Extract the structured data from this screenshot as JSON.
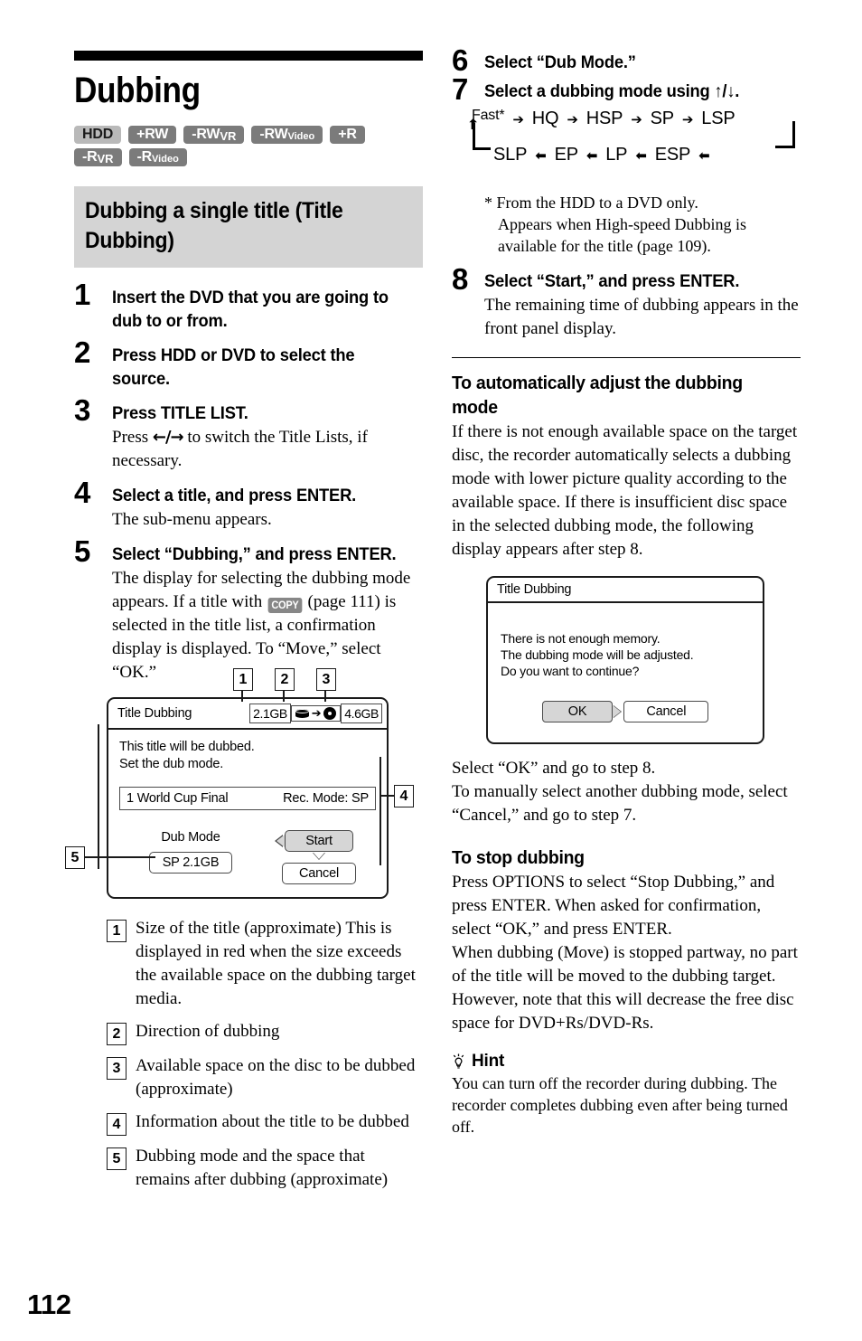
{
  "page": {
    "number": "112"
  },
  "left": {
    "chapter_title": "Dubbing",
    "media_badges": [
      {
        "name": "HDD",
        "main": "HDD",
        "sub": "",
        "style": "light"
      },
      {
        "name": "+RW",
        "main": "+RW",
        "sub": "",
        "style": "dark"
      },
      {
        "name": "-RWVR",
        "main": "-RW",
        "sub": "VR",
        "style": "dark"
      },
      {
        "name": "-RWVideo",
        "main": "-RW",
        "sub": "Video",
        "style": "dark"
      },
      {
        "name": "+R",
        "main": "+R",
        "sub": "",
        "style": "dark"
      },
      {
        "name": "-RVR",
        "main": "-R",
        "sub": "VR",
        "style": "dark"
      },
      {
        "name": "-RVideo",
        "main": "-R",
        "sub": "Video",
        "style": "dark"
      }
    ],
    "section_heading": "Dubbing a single title (Title Dubbing)",
    "steps": [
      {
        "num": "1",
        "title": "Insert the DVD that you are going to dub to or from.",
        "body": ""
      },
      {
        "num": "2",
        "title": "Press HDD or DVD to select the source.",
        "body": ""
      },
      {
        "num": "3",
        "title": "Press TITLE LIST.",
        "body_pre": "Press ",
        "body_arrows": "←/→",
        "body_post": " to switch the Title Lists, if necessary."
      },
      {
        "num": "4",
        "title": "Select a title, and press ENTER.",
        "body": "The sub-menu appears."
      },
      {
        "num": "5",
        "title": "Select “Dubbing,” and press ENTER.",
        "body_line1": "The display for selecting the dubbing mode appears.",
        "body_line2_pre": "If a title with ",
        "copy_badge": "COPY",
        "body_line2_post": " (page 111) is selected in the title list, a confirmation display is displayed.",
        "body_line3": "To “Move,” select “OK.”"
      }
    ],
    "dialog": {
      "title": "Title Dubbing",
      "size_source": "2.1GB",
      "direction_arrow": "➔",
      "size_target": "4.6GB",
      "message_line1": "This title will be dubbed.",
      "message_line2": "Set the dub mode.",
      "title_row_name": "1  World Cup Final",
      "title_row_mode": "Rec. Mode: SP",
      "dub_mode_label": "Dub Mode",
      "dub_mode_value": "SP 2.1GB",
      "start_button": "Start",
      "cancel_button": "Cancel",
      "callouts": [
        "1",
        "2",
        "3",
        "4",
        "5"
      ]
    },
    "legend": [
      {
        "num": "1",
        "text": "Size of the title (approximate) This is displayed in red when the size exceeds the available space on the dubbing target media."
      },
      {
        "num": "2",
        "text": "Direction of dubbing"
      },
      {
        "num": "3",
        "text": "Available space on the disc to be dubbed (approximate)"
      },
      {
        "num": "4",
        "text": "Information about the title to be dubbed"
      },
      {
        "num": "5",
        "text": "Dubbing mode and the space that remains after dubbing (approximate)"
      }
    ]
  },
  "right": {
    "steps": [
      {
        "num": "6",
        "title": "Select “Dub Mode.”"
      },
      {
        "num": "7",
        "title": "Select a dubbing mode using ↑/↓."
      },
      {
        "num": "8",
        "title": "Select “Start,” and press ENTER.",
        "body": "The remaining time of dubbing appears in the front panel display."
      }
    ],
    "flow": {
      "row1": [
        "Fast*",
        "HQ",
        "HSP",
        "SP",
        "LSP"
      ],
      "row2": [
        "SLP",
        "EP",
        "LP",
        "ESP"
      ],
      "arrow_right": "➔",
      "arrow_left": "⬅",
      "arrow_up": "⬆"
    },
    "footnote": {
      "marker": "*",
      "line1": "From the HDD to a DVD only.",
      "line2": "Appears when High-speed Dubbing is available for the title (page 109)."
    },
    "auto_adjust": {
      "heading": "To automatically adjust the dubbing mode",
      "body": "If there is not enough available space on the target disc, the recorder automatically selects a dubbing mode with lower picture quality according to the available space. If there is insufficient disc space in the selected dubbing mode, the following display appears after step 8."
    },
    "dialog2": {
      "title": "Title Dubbing",
      "msg_line1": "There is not enough memory.",
      "msg_line2": "The dubbing mode will be adjusted.",
      "msg_line3": "Do you want to continue?",
      "ok_button": "OK",
      "cancel_button": "Cancel"
    },
    "after_dialog": {
      "line1": "Select “OK” and go to step 8.",
      "line2": "To manually select another dubbing mode, select “Cancel,” and go to step 7."
    },
    "stop_dubbing": {
      "heading": "To stop dubbing",
      "body1": "Press OPTIONS to select “Stop Dubbing,” and press ENTER. When asked for confirmation, select “OK,” and press ENTER.",
      "body2": "When dubbing (Move) is stopped partway, no part of the title will be moved to the dubbing target. However, note that this will decrease the free disc space for DVD+Rs/DVD-Rs."
    },
    "hint": {
      "label": "Hint",
      "body": "You can turn off the recorder during dubbing. The recorder completes dubbing even after being turned off."
    }
  }
}
